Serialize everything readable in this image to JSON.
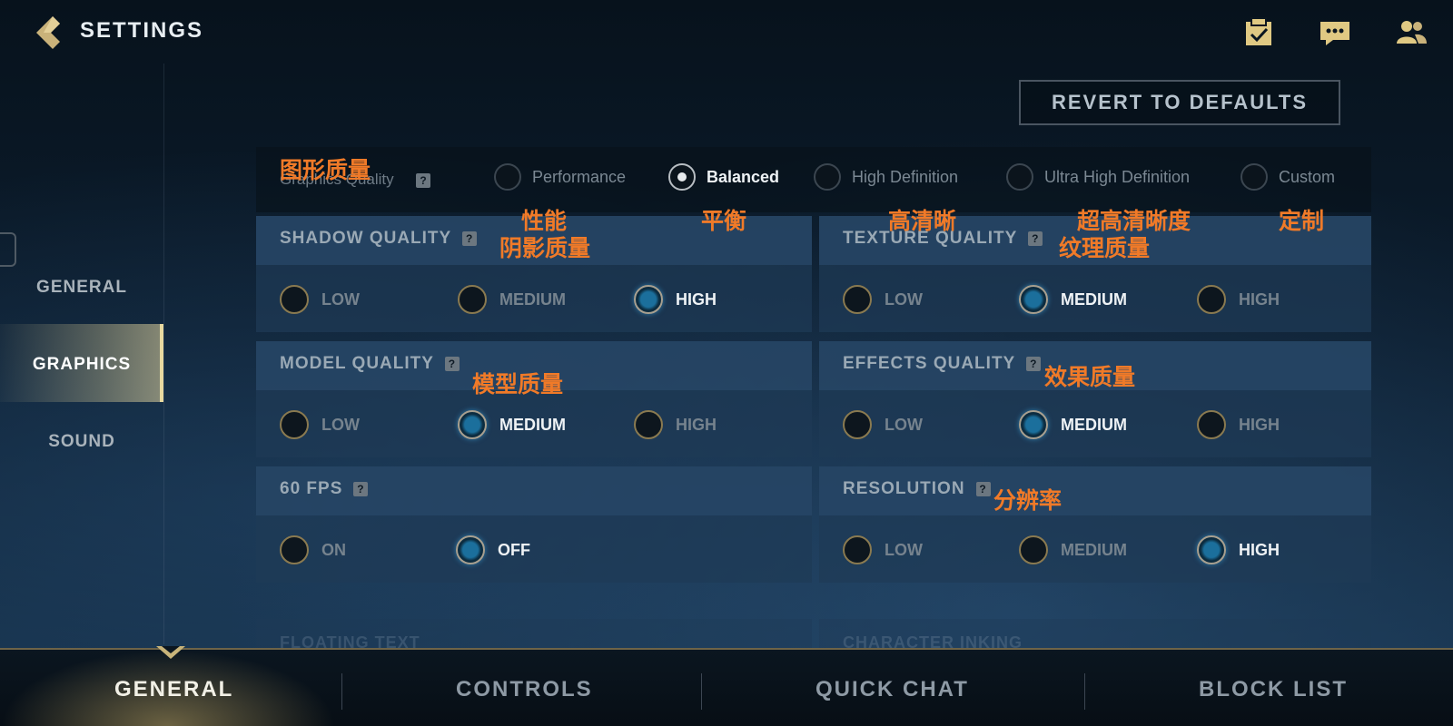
{
  "header": {
    "title": "SETTINGS",
    "icons": [
      "back-icon",
      "checklist-icon",
      "chat-icon",
      "friends-icon"
    ]
  },
  "revert_label": "REVERT TO DEFAULTS",
  "sidebar": {
    "items": [
      {
        "label": "GENERAL"
      },
      {
        "label": "GRAPHICS",
        "active": true
      },
      {
        "label": "SOUND"
      }
    ]
  },
  "graphics_quality": {
    "label": "Graphics Quality",
    "help": "?",
    "options": [
      "Performance",
      "Balanced",
      "High Definition",
      "Ultra High Definition",
      "Custom"
    ],
    "selected": "Balanced"
  },
  "panels": {
    "shadow": {
      "title": "SHADOW QUALITY",
      "options": [
        "LOW",
        "MEDIUM",
        "HIGH"
      ],
      "selected": "HIGH"
    },
    "texture": {
      "title": "TEXTURE QUALITY",
      "options": [
        "LOW",
        "MEDIUM",
        "HIGH"
      ],
      "selected": "MEDIUM"
    },
    "model": {
      "title": "MODEL QUALITY",
      "options": [
        "LOW",
        "MEDIUM",
        "HIGH"
      ],
      "selected": "MEDIUM"
    },
    "effects": {
      "title": "EFFECTS QUALITY",
      "options": [
        "LOW",
        "MEDIUM",
        "HIGH"
      ],
      "selected": "MEDIUM"
    },
    "fps": {
      "title": "60 FPS",
      "options": [
        "ON",
        "OFF"
      ],
      "selected": "OFF"
    },
    "resolution": {
      "title": "RESOLUTION",
      "options": [
        "LOW",
        "MEDIUM",
        "HIGH"
      ],
      "selected": "HIGH"
    }
  },
  "ghost_titles": {
    "left": "FLOATING TEXT",
    "right": "CHARACTER INKING"
  },
  "annotations": {
    "graphics_quality": "图形质量",
    "performance": "性能",
    "balanced": "平衡",
    "high_definition": "高清晰",
    "ultra_high_definition": "超高清晰度",
    "custom": "定制",
    "shadow_quality": "阴影质量",
    "texture_quality": "纹理质量",
    "model_quality": "模型质量",
    "effects_quality": "效果质量",
    "resolution": "分辨率"
  },
  "bottom_tabs": [
    {
      "label": "GENERAL",
      "active": true
    },
    {
      "label": "CONTROLS"
    },
    {
      "label": "QUICK CHAT"
    },
    {
      "label": "BLOCK LIST"
    }
  ],
  "colors": {
    "accent_gold": "#c8b47a",
    "selected_blue": "#1b6f9c",
    "annotation_orange": "#f07a28"
  }
}
